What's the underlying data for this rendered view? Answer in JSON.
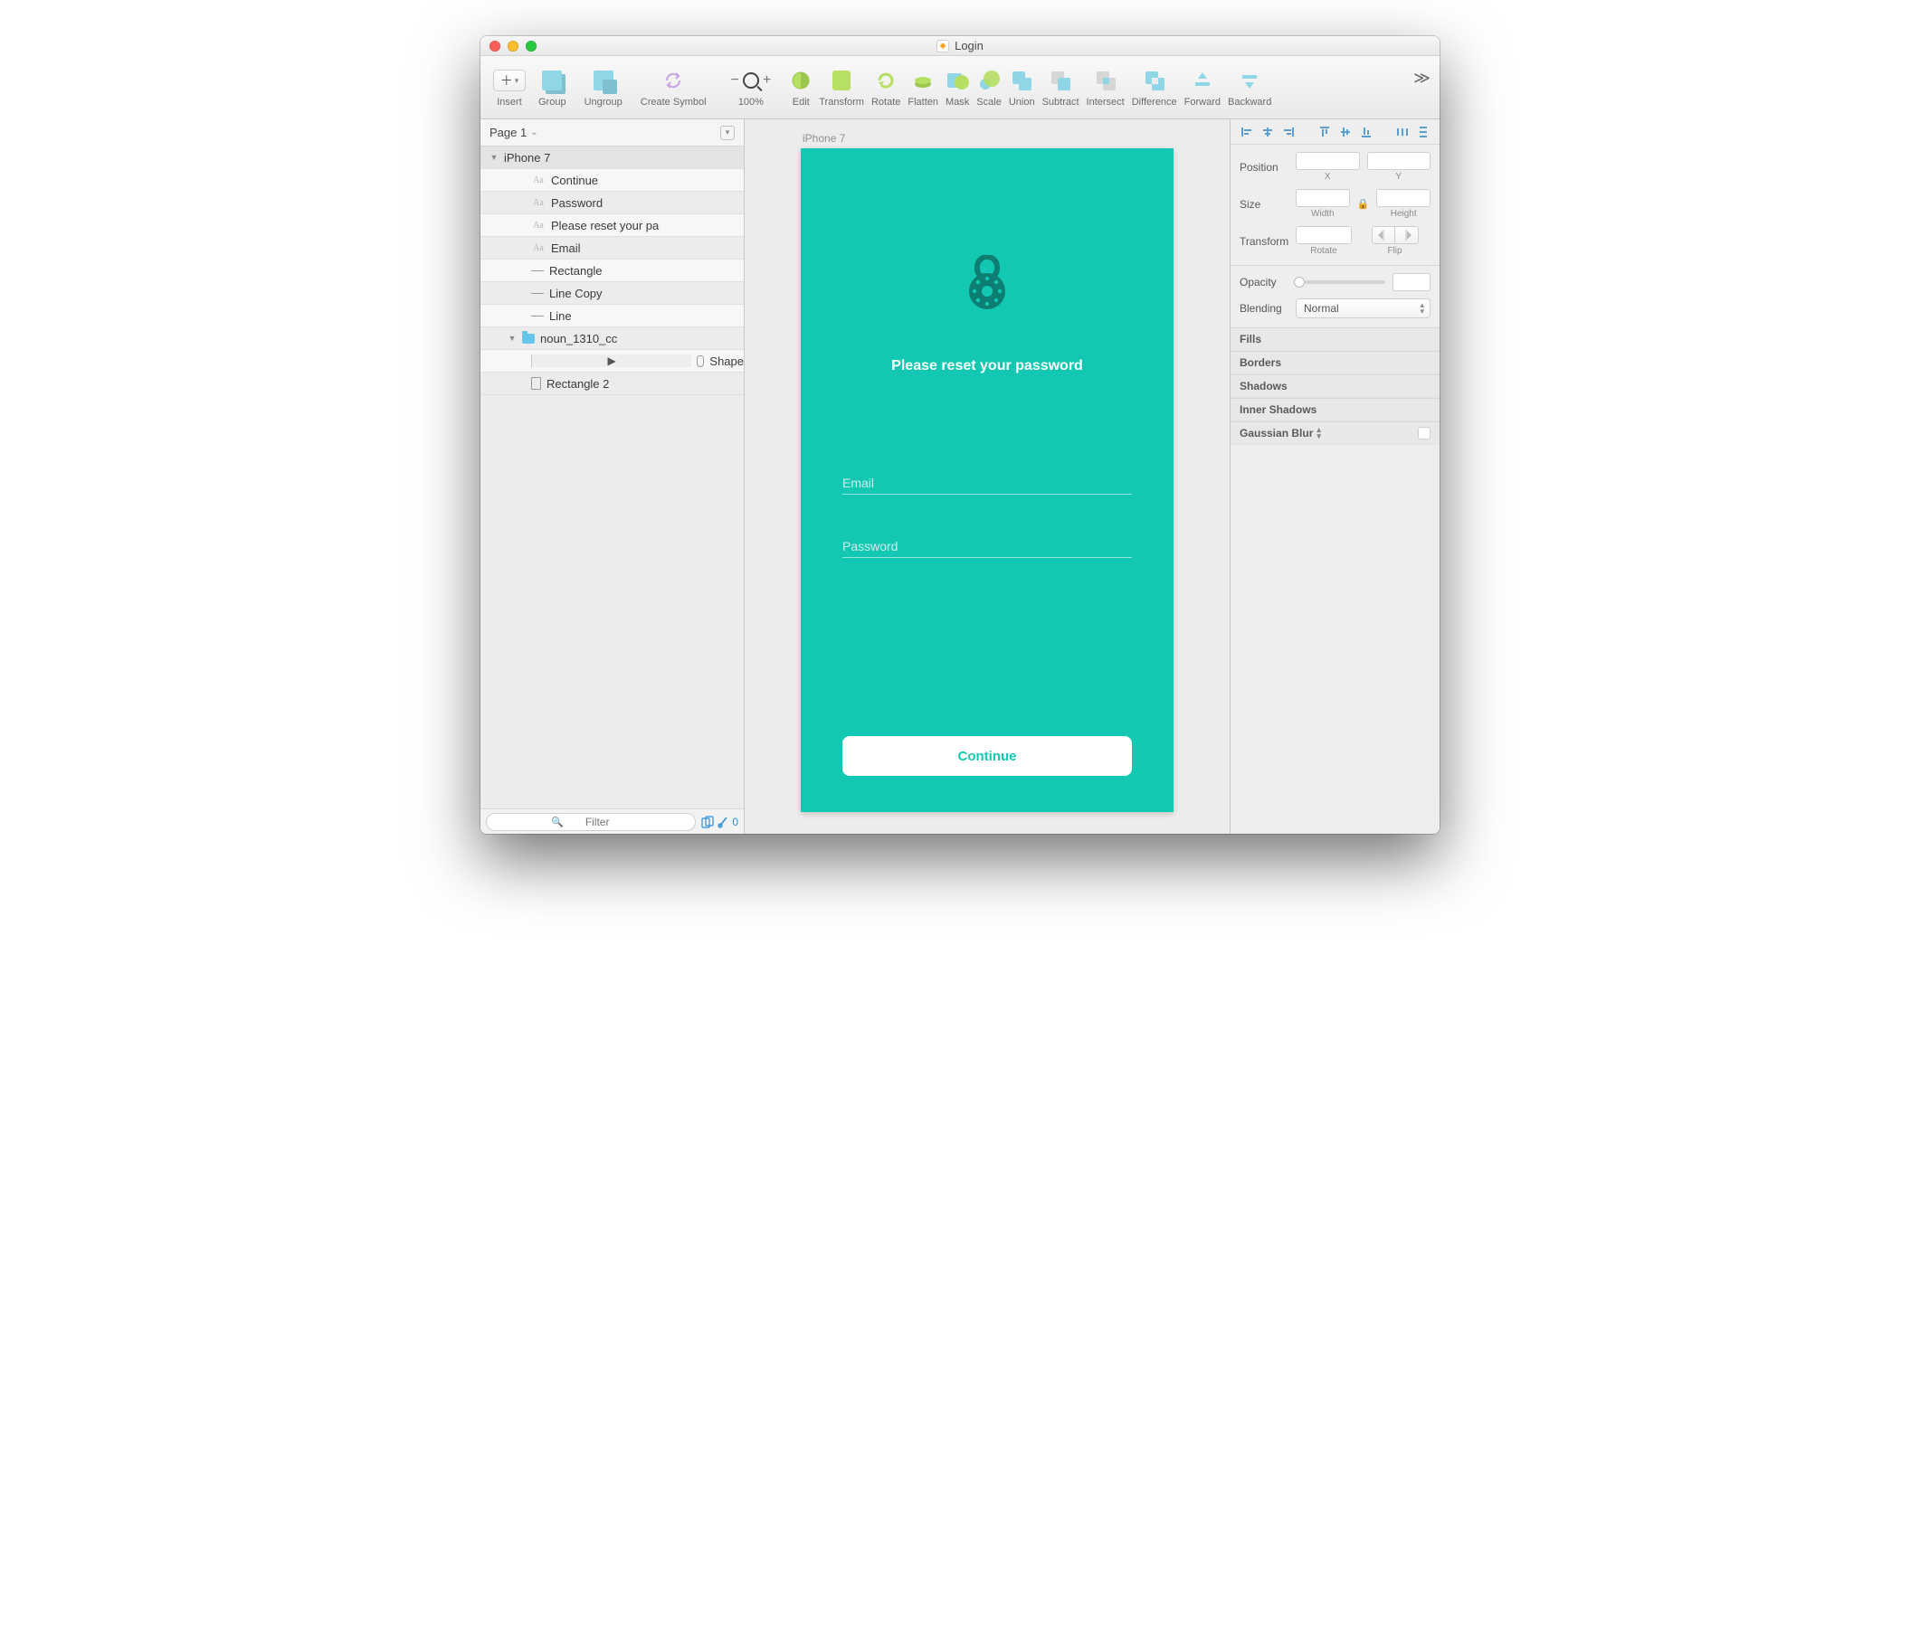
{
  "window": {
    "title": "Login"
  },
  "toolbar": {
    "insert": "Insert",
    "group": "Group",
    "ungroup": "Ungroup",
    "create_symbol": "Create Symbol",
    "zoom": "100%",
    "edit": "Edit",
    "transform": "Transform",
    "rotate": "Rotate",
    "flatten": "Flatten",
    "mask": "Mask",
    "scale": "Scale",
    "union": "Union",
    "subtract": "Subtract",
    "intersect": "Intersect",
    "difference": "Difference",
    "forward": "Forward",
    "backward": "Backward"
  },
  "pages": {
    "current": "Page 1"
  },
  "layers": {
    "artboard": "iPhone 7",
    "items": [
      "Continue",
      "Password",
      "Please reset your pa",
      "Email",
      "Rectangle",
      "Line Copy",
      "Line"
    ],
    "folder": "noun_1310_cc",
    "shape": "Shape",
    "rect2": "Rectangle 2"
  },
  "filter": {
    "placeholder": "Filter",
    "count": "0"
  },
  "canvas": {
    "artboard_label": "iPhone 7",
    "heading": "Please reset your password",
    "email": "Email",
    "password": "Password",
    "cta": "Continue"
  },
  "inspector": {
    "position": "Position",
    "x": "X",
    "y": "Y",
    "size": "Size",
    "width": "Width",
    "height": "Height",
    "transform": "Transform",
    "rotate": "Rotate",
    "flip": "Flip",
    "opacity": "Opacity",
    "blending": "Blending",
    "blend_value": "Normal",
    "fills": "Fills",
    "borders": "Borders",
    "shadows": "Shadows",
    "inner_shadows": "Inner Shadows",
    "gaussian_blur": "Gaussian Blur"
  }
}
